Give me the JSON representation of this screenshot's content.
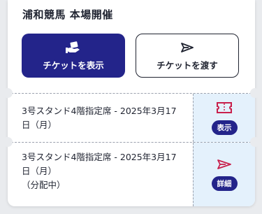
{
  "event": {
    "title": "浦和競馬 本場開催"
  },
  "actions": {
    "show_label": "チケットを表示",
    "give_label": "チケットを渡す"
  },
  "tickets": [
    {
      "text": "3号スタンド4階指定席 - 2025年3月17日（月）",
      "status": "",
      "action_label": "表示",
      "icon": "ticket-icon"
    },
    {
      "text": "3号スタンド4階指定席 - 2025年3月17日（月）",
      "status": "（分配中）",
      "action_label": "詳細",
      "icon": "send-icon"
    }
  ],
  "colors": {
    "primary": "#23248a",
    "accent": "#c8204c",
    "side_bg": "#e4f1fc"
  }
}
